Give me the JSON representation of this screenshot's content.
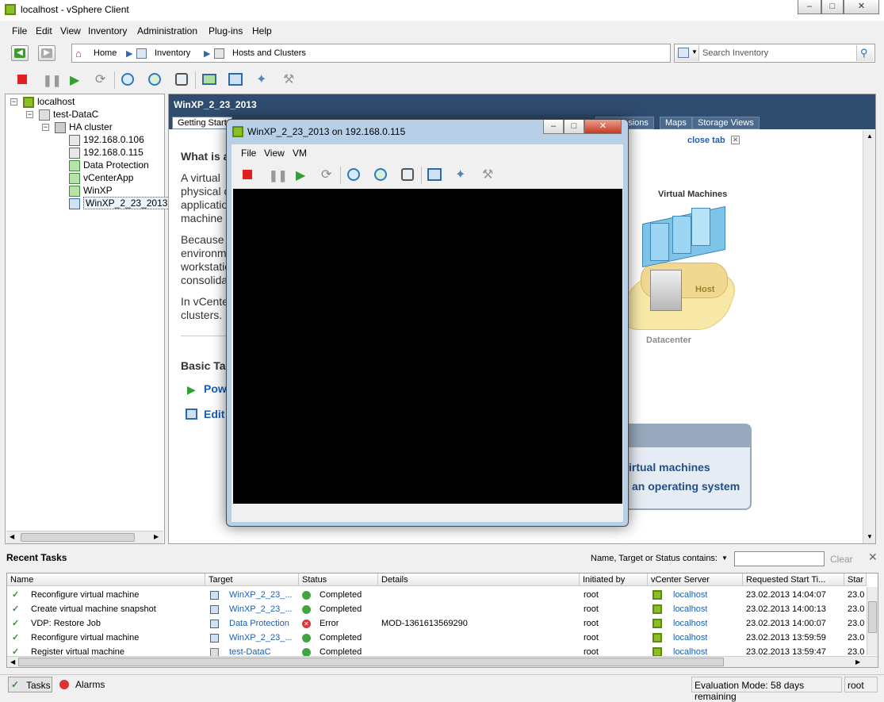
{
  "window": {
    "title": "localhost - vSphere Client"
  },
  "menu": [
    "File",
    "Edit",
    "View",
    "Inventory",
    "Administration",
    "Plug-ins",
    "Help"
  ],
  "breadcrumb": {
    "home": "Home",
    "inventory": "Inventory",
    "hosts": "Hosts and Clusters"
  },
  "search": {
    "placeholder": "Search Inventory"
  },
  "tree": {
    "root": "localhost",
    "datacenter": "test-DataC",
    "cluster": "HA cluster",
    "items": [
      "192.168.0.106",
      "192.168.0.115",
      "Data Protection",
      "vCenterApp",
      "WinXP",
      "WinXP_2_23_2013"
    ]
  },
  "main": {
    "header": "WinXP_2_23_2013",
    "tabs": [
      "Getting Start",
      "Permissions",
      "Maps",
      "Storage Views"
    ],
    "close_tab": "close tab",
    "what_is": "What is a",
    "para1": [
      "A virtual",
      "physical c",
      "applicatio",
      "machine"
    ],
    "para2": [
      "Because",
      "environm",
      "workstatio",
      "consolida"
    ],
    "para3": [
      "In vCente",
      "clusters."
    ],
    "basic_tasks": "Basic Ta",
    "power": "Pow",
    "edit": "Edit",
    "diagram": {
      "vms": "Virtual Machines",
      "host": "Host",
      "datacenter": "Datacenter"
    },
    "bottom_box": {
      "line1": "irtual machines",
      "line2": "an operating system"
    }
  },
  "console": {
    "title": "WinXP_2_23_2013 on 192.168.0.115",
    "menu": [
      "File",
      "View",
      "VM"
    ]
  },
  "tasks": {
    "title": "Recent Tasks",
    "filter_label": "Name, Target or Status contains:",
    "clear": "Clear",
    "columns": [
      "Name",
      "Target",
      "Status",
      "Details",
      "Initiated by",
      "vCenter Server",
      "Requested Start Ti...",
      "Star"
    ],
    "rows": [
      {
        "name": "Reconfigure virtual machine",
        "target": "WinXP_2_23_...",
        "status": "Completed",
        "details": "",
        "by": "root",
        "server": "localhost",
        "time": "23.02.2013 14:04:07",
        "start": "23.0"
      },
      {
        "name": "Create virtual machine snapshot",
        "target": "WinXP_2_23_...",
        "status": "Completed",
        "details": "",
        "by": "root",
        "server": "localhost",
        "time": "23.02.2013 14:00:13",
        "start": "23.0"
      },
      {
        "name": "VDP: Restore Job",
        "target": "Data Protection",
        "status": "Error",
        "details": "MOD-1361613569290",
        "by": "root",
        "server": "localhost",
        "time": "23.02.2013 14:00:07",
        "start": "23.0"
      },
      {
        "name": "Reconfigure virtual machine",
        "target": "WinXP_2_23_...",
        "status": "Completed",
        "details": "",
        "by": "root",
        "server": "localhost",
        "time": "23.02.2013 13:59:59",
        "start": "23.0"
      },
      {
        "name": "Register virtual machine",
        "target": "test-DataC",
        "status": "Completed",
        "details": "",
        "by": "root",
        "server": "localhost",
        "time": "23.02.2013 13:59:47",
        "start": "23.0"
      }
    ]
  },
  "statusbar": {
    "tasks": "Tasks",
    "alarms": "Alarms",
    "eval": "Evaluation Mode: 58 days remaining",
    "user": "root"
  }
}
